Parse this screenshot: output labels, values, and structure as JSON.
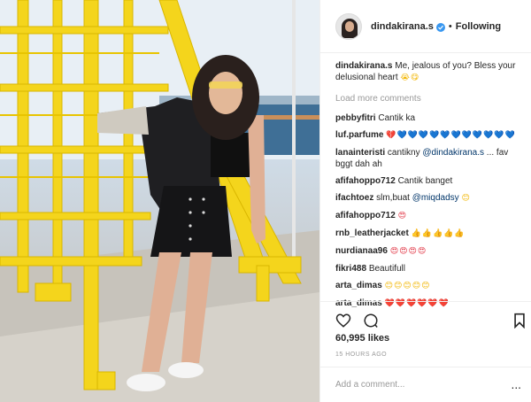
{
  "post": {
    "username": "dindakirana.s",
    "separator": "•",
    "follow_status": "Following",
    "caption": {
      "author": "dindakirana.s",
      "text": "Me, jealous of you? Bless your delusional heart",
      "emoji": "😭😋"
    },
    "load_more": "Load more comments",
    "comments": [
      {
        "author": "pebbyfitri",
        "text": "Cantik ka",
        "emoji": "",
        "emoji_color": ""
      },
      {
        "author": "luf.parfume",
        "text": "",
        "emoji": "💔💙💙💙💙💙💙💙💙💙💙💙",
        "emoji_color": "blue"
      },
      {
        "author": "lanainteristi",
        "text": "cantikny @dindakirana.s ... fav bggt dah ah",
        "emoji": "",
        "emoji_color": ""
      },
      {
        "author": "afifahoppo712",
        "text": "Cantik banget",
        "emoji": "",
        "emoji_color": ""
      },
      {
        "author": "ifachtoez",
        "text": "slm,buat @miqdadsy",
        "emoji": "😊",
        "emoji_color": "yel"
      },
      {
        "author": "afifahoppo712",
        "text": "",
        "emoji": "😍",
        "emoji_color": "red"
      },
      {
        "author": "rnb_leatherjacket",
        "text": "",
        "emoji": "👍👍👍👍👍",
        "emoji_color": "yel"
      },
      {
        "author": "nurdianaa96",
        "text": "",
        "emoji": "😍😍😍😍",
        "emoji_color": "red"
      },
      {
        "author": "fikri488",
        "text": "Beautifull",
        "emoji": "",
        "emoji_color": ""
      },
      {
        "author": "arta_dimas",
        "text": "",
        "emoji": "😊😊😊😊😊",
        "emoji_color": "yel"
      },
      {
        "author": "arta_dimas",
        "text": "",
        "emoji": "❤️❤️❤️❤️❤️❤️",
        "emoji_color": "red"
      }
    ],
    "likes": "60,995 likes",
    "timestamp": "15 HOURS AGO",
    "add_comment_placeholder": "Add a comment...",
    "more_options": "..."
  },
  "icons": [
    "heart-icon",
    "comment-icon",
    "bookmark-icon",
    "verified-badge-icon",
    "more-options-icon"
  ],
  "colors": {
    "scaffold_yellow": "#f4d51c",
    "verified_blue": "#3897f0",
    "muted_text": "#999999"
  }
}
